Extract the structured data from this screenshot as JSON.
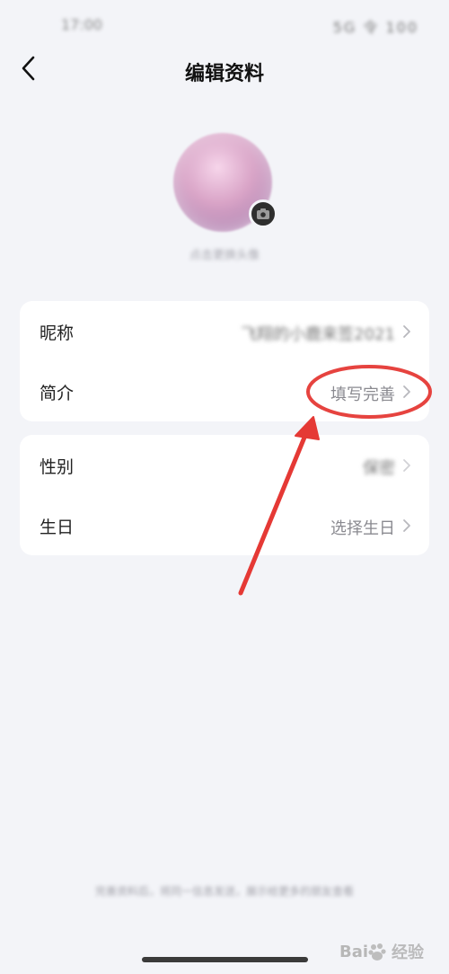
{
  "status_bar": {
    "time": "17:00",
    "icons": "5G 令 100"
  },
  "header": {
    "title": "编辑资料",
    "back_icon": "chevron-left-icon"
  },
  "avatar": {
    "caption": "点击更换头像",
    "camera_icon": "camera-icon"
  },
  "profile_card": {
    "rows": [
      {
        "label": "昵称",
        "value": "飞翔的小鹿来签2021"
      },
      {
        "label": "简介",
        "value": "填写完善"
      }
    ]
  },
  "personal_card": {
    "rows": [
      {
        "label": "性别",
        "value": "保密"
      },
      {
        "label": "生日",
        "value": "选择生日"
      }
    ]
  },
  "footer": {
    "note": "完善资料后，将同一信息发送，展示给更多的朋友查看"
  },
  "annotation": {
    "color": "#e53935"
  },
  "watermark": {
    "text": "经验"
  }
}
